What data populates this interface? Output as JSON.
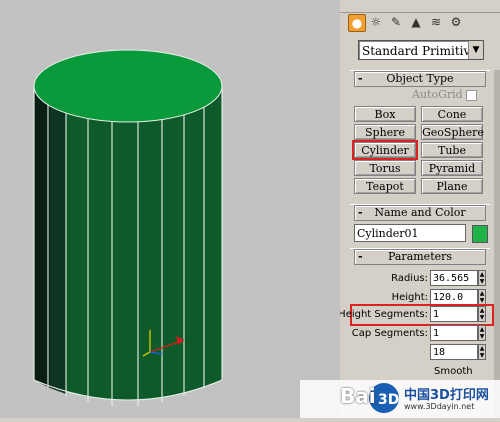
{
  "toolbar": {
    "icons": [
      "sphere-icon",
      "light-icon",
      "camera-icon",
      "helper-icon",
      "spacewarp-icon",
      "systems-icon"
    ],
    "top_icons": [
      "edit-icon",
      "rename-icon",
      "shade-icon",
      "eye-icon",
      "wrench-icon"
    ]
  },
  "dropdown": {
    "value": "Standard Primitiv"
  },
  "object_type": {
    "title": "Object Type",
    "autogrid_label": "AutoGrid",
    "buttons": [
      "Box",
      "Cone",
      "Sphere",
      "GeoSphere",
      "Cylinder",
      "Tube",
      "Torus",
      "Pyramid",
      "Teapot",
      "Plane"
    ],
    "selected": "Cylinder"
  },
  "name_color": {
    "title": "Name and Color",
    "name": "Cylinder01",
    "color": "#1fb34a"
  },
  "parameters": {
    "title": "Parameters",
    "radius_label": "Radius:",
    "radius_value": "36.565",
    "height_label": "Height:",
    "height_value": "120.0",
    "height_segments_label": "Height Segments:",
    "height_segments_value": "1",
    "cap_segments_label": "Cap Segments:",
    "cap_segments_value": "1",
    "sides_value": "18",
    "smooth_label": "Smooth"
  },
  "watermark": {
    "baidu": "Bai",
    "site": "中国3D打印网",
    "url": "www.3Ddayin.net"
  },
  "colors": {
    "cylinder_top": "#0a9a3c",
    "cylinder_side": "#0e5a2a",
    "highlight": "#dd2222"
  }
}
